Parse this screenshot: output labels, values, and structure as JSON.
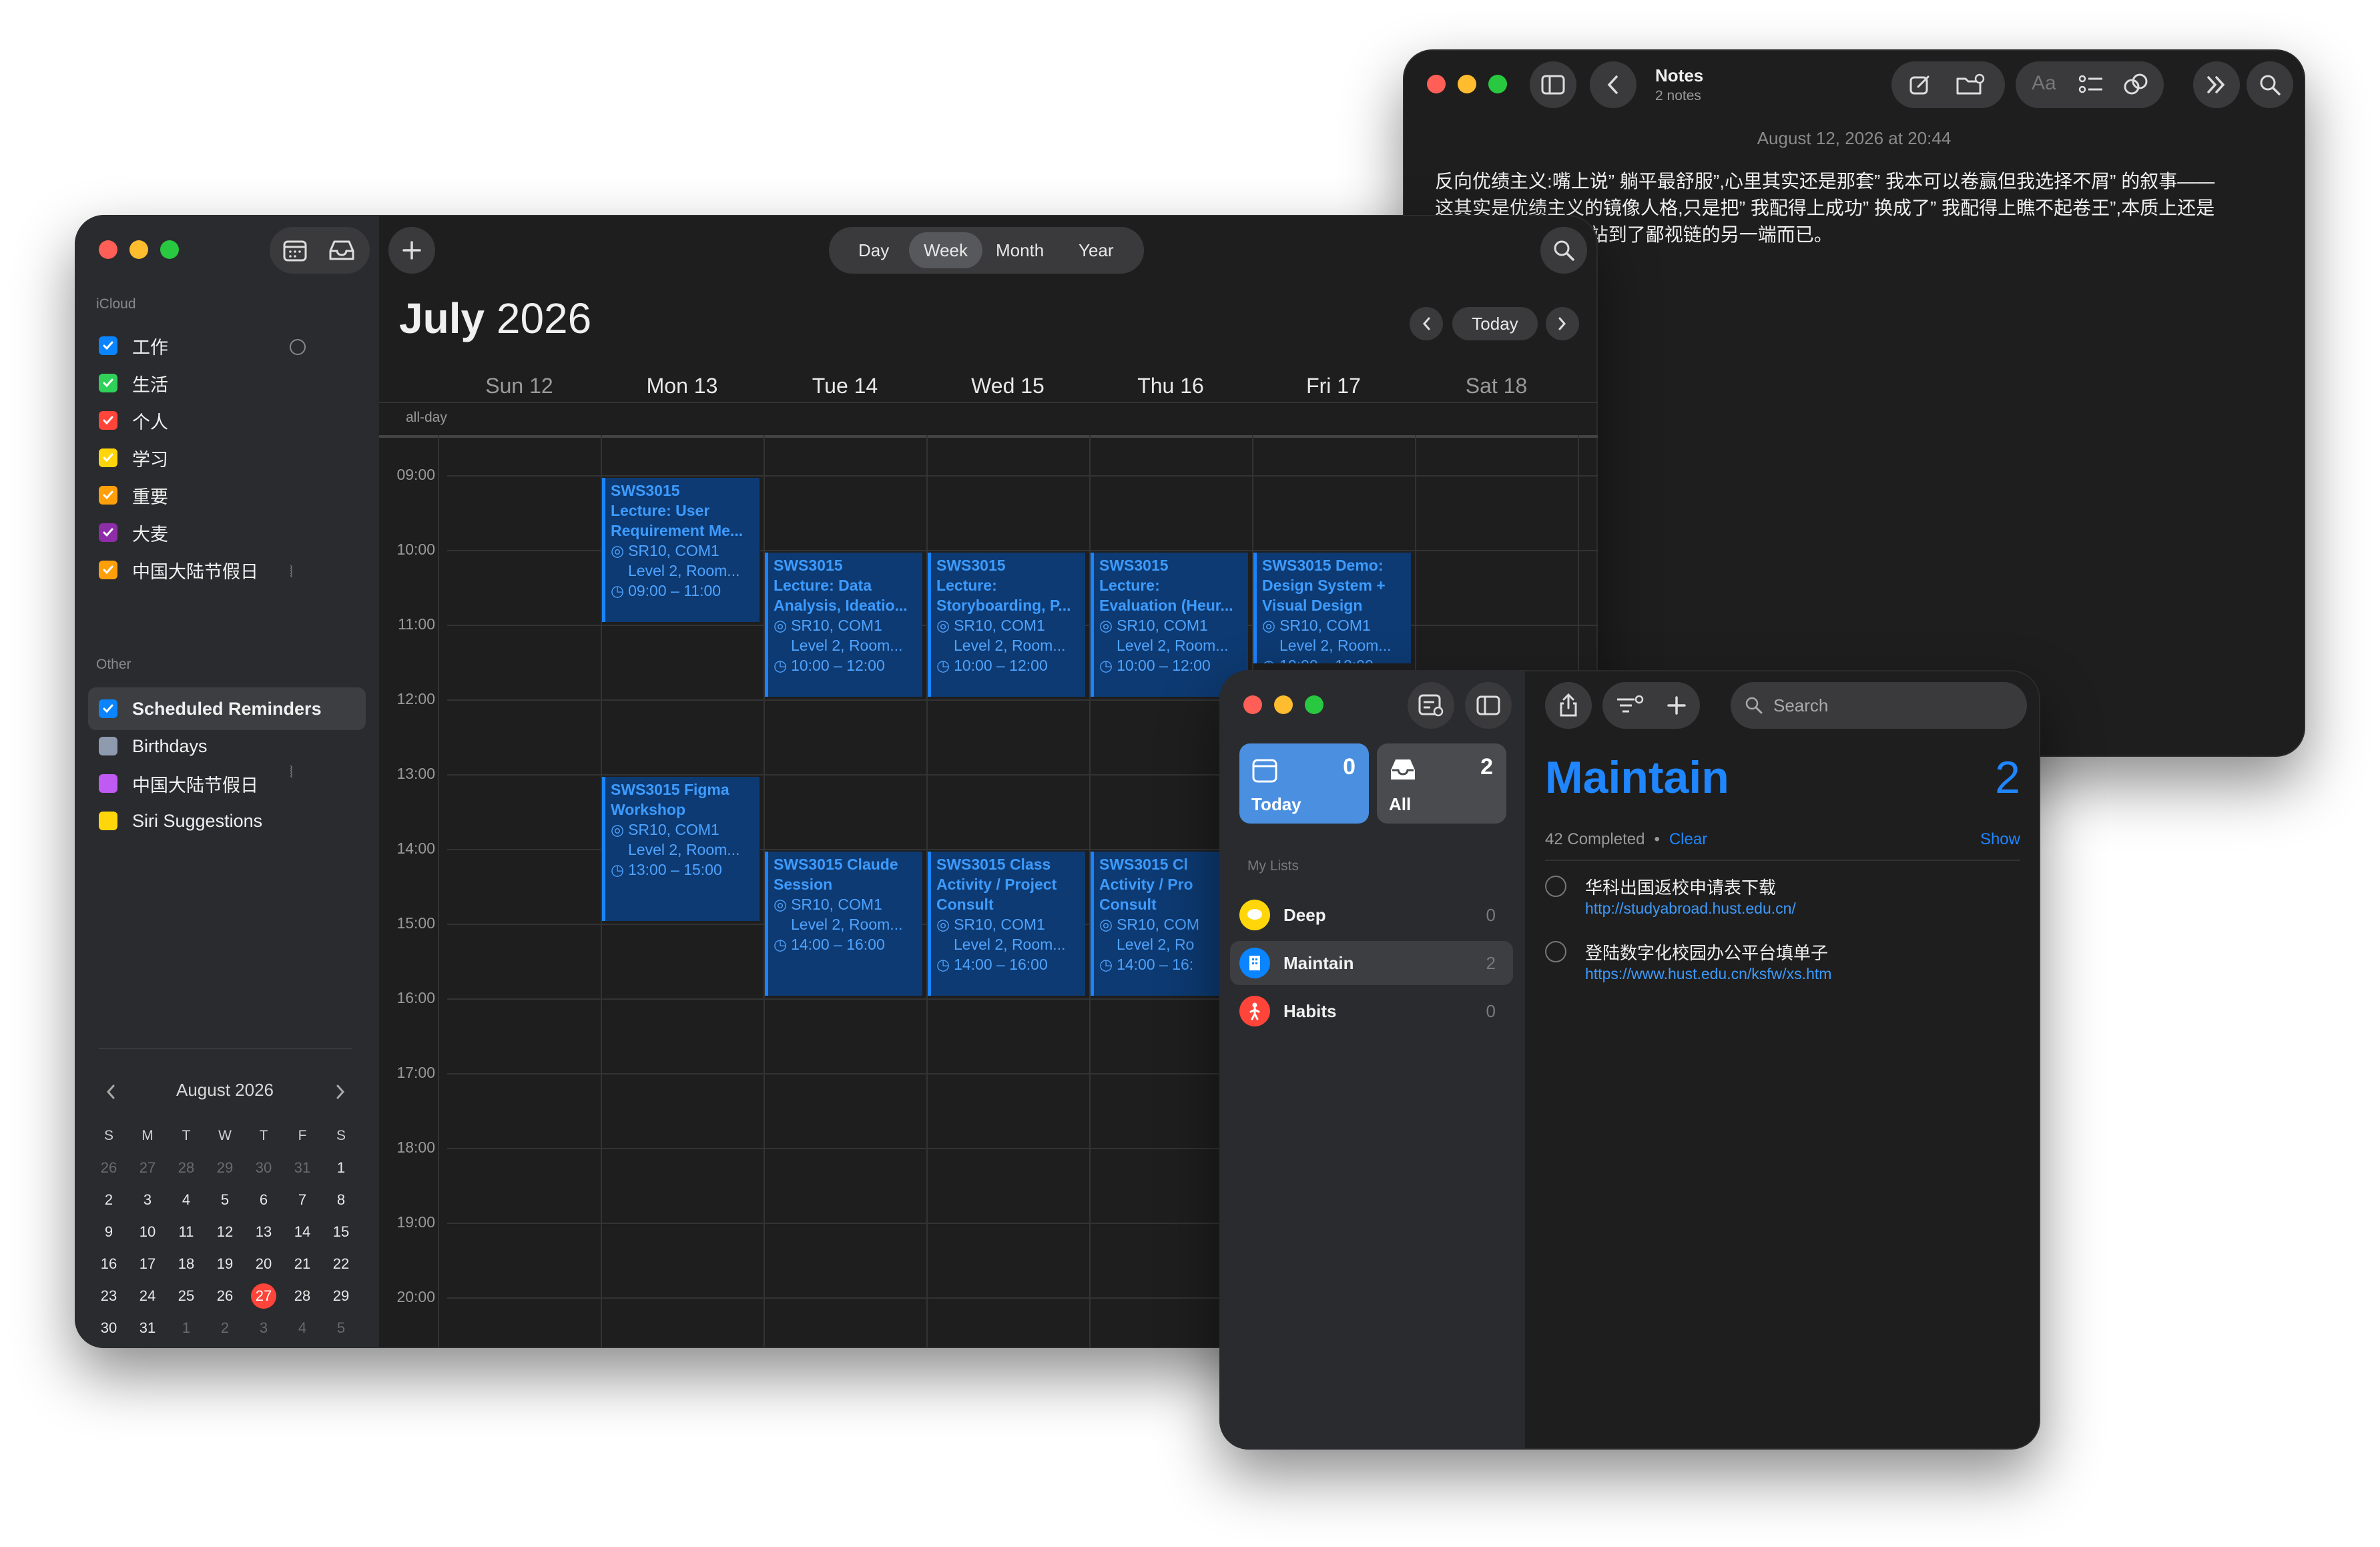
{
  "notes": {
    "title": "Notes",
    "subtitle": "2 notes",
    "date": "August 12, 2026 at 20:44",
    "font_label": "Aa",
    "body_lines": [
      "反向优绩主义:嘴上说” 躺平最舒服”,心里其实还是那套” 我本可以卷赢但我选择不屑” 的叙事——",
      "这其实是优绩主义的镜像人格,只是把” 我配得上成功” 换成了” 我配得上瞧不起卷王”,本质上还是",
      "系给自己贴金,只是站到了鄙视链的另一端而已。"
    ]
  },
  "calendar": {
    "view_tabs": [
      "Day",
      "Week",
      "Month",
      "Year"
    ],
    "selected_view": "Week",
    "month_title": "July",
    "year_title": "2026",
    "today_button": "Today",
    "allday_label": "all-day",
    "icloud_header": "iCloud",
    "icloud_calendars": [
      {
        "name": "工作",
        "color": "#0a84ff"
      },
      {
        "name": "生活",
        "color": "#30d158"
      },
      {
        "name": "个人",
        "color": "#ff453a"
      },
      {
        "name": "学习",
        "color": "#ffd60a"
      },
      {
        "name": "重要",
        "color": "#ff9f0a"
      },
      {
        "name": "大麦",
        "color": "#8e2da8"
      },
      {
        "name": "中国大陆节假日",
        "color": "#ff9f0a"
      }
    ],
    "other_header": "Other",
    "other_calendars": [
      {
        "name": "Scheduled Reminders",
        "color": "#0a84ff",
        "checked": true
      },
      {
        "name": "Birthdays",
        "color": "#8e9aae",
        "checked": false
      },
      {
        "name": "中国大陆节假日",
        "color": "#bf5af2",
        "checked": false
      },
      {
        "name": "Siri Suggestions",
        "color": "#ffd60a",
        "checked": false
      }
    ],
    "days": [
      "Sun 12",
      "Mon 13",
      "Tue 14",
      "Wed 15",
      "Thu 16",
      "Fri 17",
      "Sat 18"
    ],
    "hours": [
      "09:00",
      "10:00",
      "11:00",
      "12:00",
      "13:00",
      "14:00",
      "15:00",
      "16:00",
      "17:00",
      "18:00",
      "19:00",
      "20:00"
    ],
    "events": [
      {
        "day": 1,
        "start": 9,
        "end": 11,
        "lines": [
          "SWS3015",
          "Lecture: User",
          "Requirement Me..."
        ],
        "loc": [
          "SR10, COM1",
          "Level 2, Room..."
        ],
        "time": "09:00 – 11:00"
      },
      {
        "day": 2,
        "start": 10,
        "end": 12,
        "lines": [
          "SWS3015",
          "Lecture: Data",
          "Analysis, Ideatio..."
        ],
        "loc": [
          "SR10, COM1",
          "Level 2, Room..."
        ],
        "time": "10:00 – 12:00"
      },
      {
        "day": 3,
        "start": 10,
        "end": 12,
        "lines": [
          "SWS3015",
          "Lecture:",
          "Storyboarding, P..."
        ],
        "loc": [
          "SR10, COM1",
          "Level 2, Room..."
        ],
        "time": "10:00 – 12:00"
      },
      {
        "day": 4,
        "start": 10,
        "end": 12,
        "lines": [
          "SWS3015",
          "Lecture:",
          "Evaluation (Heur..."
        ],
        "loc": [
          "SR10, COM1",
          "Level 2, Room..."
        ],
        "time": "10:00 – 12:00"
      },
      {
        "day": 5,
        "start": 10,
        "end": 11.55,
        "lines": [
          "SWS3015 Demo:",
          "Design System +",
          "Visual Design"
        ],
        "loc": [
          "SR10, COM1",
          "Level 2, Room..."
        ],
        "time": "10:00 – 12:00"
      },
      {
        "day": 1,
        "start": 13,
        "end": 15,
        "lines": [
          "SWS3015 Figma",
          "Workshop"
        ],
        "loc": [
          "SR10, COM1",
          "Level 2, Room..."
        ],
        "time": "13:00 – 15:00"
      },
      {
        "day": 2,
        "start": 14,
        "end": 16,
        "lines": [
          "SWS3015 Claude",
          "Session"
        ],
        "loc": [
          "SR10, COM1",
          "Level 2, Room..."
        ],
        "time": "14:00 – 16:00"
      },
      {
        "day": 3,
        "start": 14,
        "end": 16,
        "lines": [
          "SWS3015 Class",
          "Activity / Project",
          "Consult"
        ],
        "loc": [
          "SR10, COM1",
          "Level 2, Room..."
        ],
        "time": "14:00 – 16:00"
      },
      {
        "day": 4,
        "start": 14,
        "end": 16,
        "lines": [
          "SWS3015 Cl",
          "Activity / Pro",
          "Consult"
        ],
        "loc": [
          "SR10, COM",
          "Level 2, Ro"
        ],
        "time": "14:00 – 16:"
      }
    ],
    "mini": {
      "title": "August 2026",
      "weekdays": [
        "S",
        "M",
        "T",
        "W",
        "T",
        "F",
        "S"
      ],
      "weeks": [
        [
          "26",
          "27",
          "28",
          "29",
          "30",
          "31",
          "1"
        ],
        [
          "2",
          "3",
          "4",
          "5",
          "6",
          "7",
          "8"
        ],
        [
          "9",
          "10",
          "11",
          "12",
          "13",
          "14",
          "15"
        ],
        [
          "16",
          "17",
          "18",
          "19",
          "20",
          "21",
          "22"
        ],
        [
          "23",
          "24",
          "25",
          "26",
          "27",
          "28",
          "29"
        ],
        [
          "30",
          "31",
          "1",
          "2",
          "3",
          "4",
          "5"
        ]
      ],
      "today": "27"
    }
  },
  "reminders": {
    "today_label": "Today",
    "today_count": "0",
    "all_label": "All",
    "all_count": "2",
    "my_lists_header": "My Lists",
    "lists": [
      {
        "name": "Deep",
        "count": "0",
        "color": "#ffd60a"
      },
      {
        "name": "Maintain",
        "count": "2",
        "color": "#0a84ff"
      },
      {
        "name": "Habits",
        "count": "0",
        "color": "#ff453a"
      }
    ],
    "search_placeholder": "Search",
    "list_title": "Maintain",
    "list_count": "2",
    "completed_text": "42 Completed",
    "clear_label": "Clear",
    "show_label": "Show",
    "items": [
      {
        "title": "华科出国返校申请表下载",
        "url": "http://studyabroad.hust.edu.cn/"
      },
      {
        "title": "登陆数字化校园办公平台填单子",
        "url": "https://www.hust.edu.cn/ksfw/xs.htm"
      }
    ]
  }
}
